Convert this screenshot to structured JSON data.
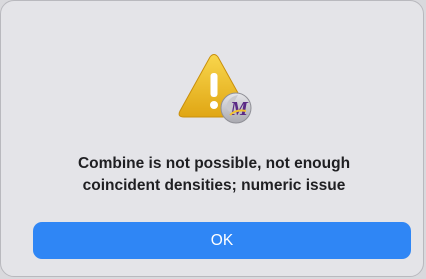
{
  "dialog": {
    "message_line1": "Combine is not possible, not enough",
    "message_line2": "coincident densities; numeric issue",
    "ok_label": "OK",
    "icon": "warning-triangle-with-app-badge",
    "badge_letter": "M"
  },
  "colors": {
    "dialog_background": "#e4e4e8",
    "button_accent": "#2f86f5",
    "warning_yellow": "#f2c230",
    "badge_purple": "#5b2a86"
  }
}
